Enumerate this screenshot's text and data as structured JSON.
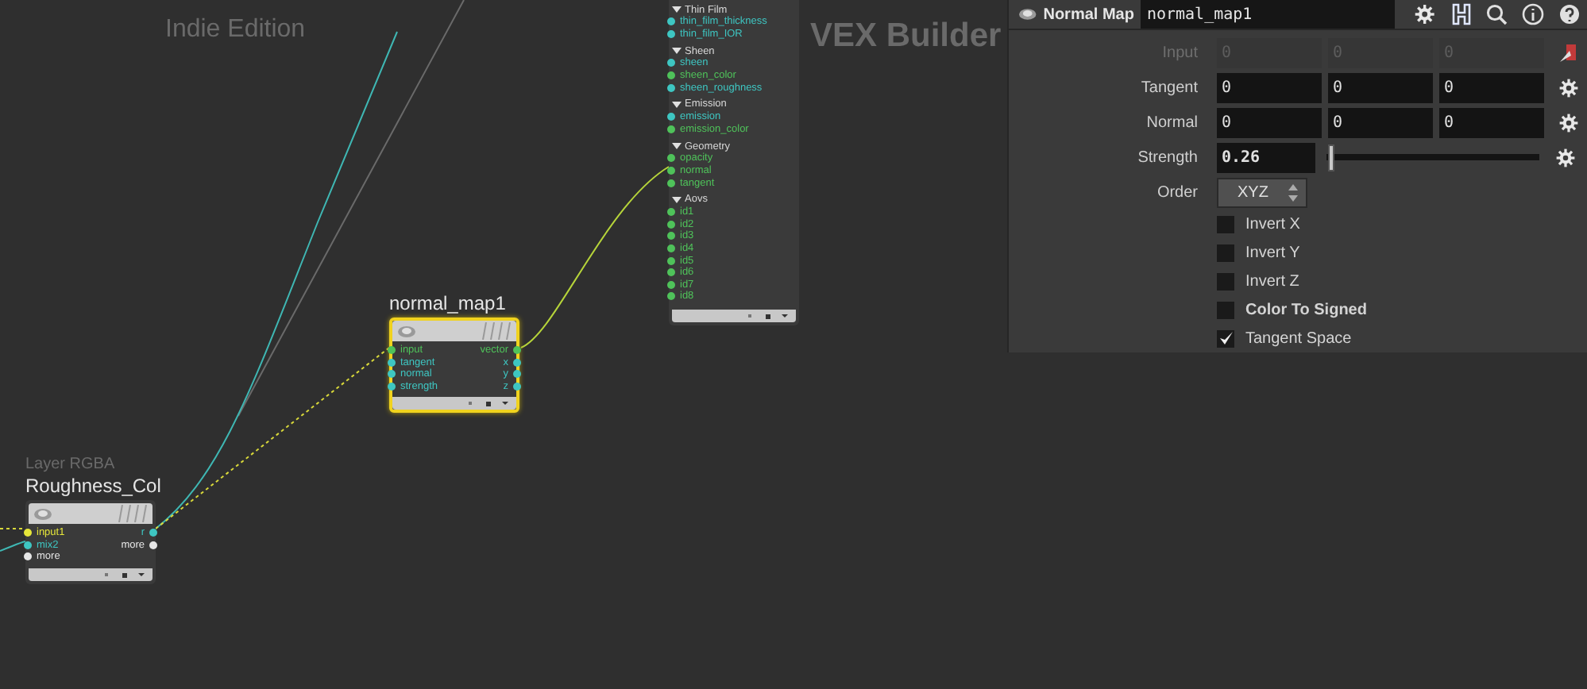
{
  "canvas": {
    "edition_label": "Indie Edition",
    "context_label": "VEX Builder"
  },
  "nodes": [
    {
      "kind": "sectioned",
      "sections": [
        {
          "title": "Thin Film",
          "ports": [
            {
              "name": "thin_film_thickness",
              "color": "#3ec6c2"
            },
            {
              "name": "thin_film_IOR",
              "color": "#3ec6c2"
            }
          ]
        },
        {
          "title": "Sheen",
          "ports": [
            {
              "name": "sheen",
              "color": "#3ec6c2"
            },
            {
              "name": "sheen_color",
              "color": "#4fc25a"
            },
            {
              "name": "sheen_roughness",
              "color": "#3ec6c2"
            }
          ]
        },
        {
          "title": "Emission",
          "ports": [
            {
              "name": "emission",
              "color": "#3ec6c2"
            },
            {
              "name": "emission_color",
              "color": "#4fc25a"
            }
          ]
        },
        {
          "title": "Geometry",
          "ports": [
            {
              "name": "opacity",
              "color": "#4fc25a"
            },
            {
              "name": "normal",
              "color": "#4fc25a"
            },
            {
              "name": "tangent",
              "color": "#4fc25a"
            }
          ]
        },
        {
          "title": "Aovs",
          "ports": [
            {
              "name": "id1",
              "color": "#4fc25a"
            },
            {
              "name": "id2",
              "color": "#4fc25a"
            },
            {
              "name": "id3",
              "color": "#4fc25a"
            },
            {
              "name": "id4",
              "color": "#4fc25a"
            },
            {
              "name": "id5",
              "color": "#4fc25a"
            },
            {
              "name": "id6",
              "color": "#4fc25a"
            },
            {
              "name": "id7",
              "color": "#4fc25a"
            },
            {
              "name": "id8",
              "color": "#4fc25a"
            }
          ]
        }
      ]
    },
    {
      "kind": "standard",
      "name": "normal_map1",
      "selected": true,
      "inputs": [
        {
          "name": "input",
          "color": "#4fc25a"
        },
        {
          "name": "tangent",
          "color": "#3ec6c2"
        },
        {
          "name": "normal",
          "color": "#3ec6c2"
        },
        {
          "name": "strength",
          "color": "#3ec6c2"
        }
      ],
      "outputs": [
        {
          "name": "vector",
          "color": "#4fc25a"
        },
        {
          "name": "x",
          "color": "#3ec6c2"
        },
        {
          "name": "y",
          "color": "#3ec6c2"
        },
        {
          "name": "z",
          "color": "#3ec6c2"
        }
      ]
    },
    {
      "kind": "standard",
      "type_label": "Layer RGBA",
      "name": "Roughness_Col",
      "selected": false,
      "inputs": [
        {
          "name": "input1",
          "color": "#e6e63a"
        },
        {
          "name": "mix2",
          "color": "#3ec6c2"
        },
        {
          "name": "more",
          "color": "#e6e6e6"
        }
      ],
      "outputs": [
        {
          "name": "r",
          "color": "#3ec6c2"
        },
        {
          "name": "more",
          "color": "#e6e6e6"
        }
      ]
    }
  ],
  "parameters": {
    "type_label": "Normal Map",
    "node_name": "normal_map1",
    "rows": [
      {
        "kind": "vector",
        "label": "Input",
        "disabled": true,
        "values": [
          "0",
          "0",
          "0"
        ]
      },
      {
        "kind": "vector",
        "label": "Tangent",
        "disabled": false,
        "values": [
          "0",
          "0",
          "0"
        ]
      },
      {
        "kind": "vector",
        "label": "Normal",
        "disabled": false,
        "values": [
          "0",
          "0",
          "0"
        ]
      },
      {
        "kind": "slider",
        "label": "Strength",
        "value": "0.26",
        "level": 0.02
      },
      {
        "kind": "menu",
        "label": "Order",
        "value": "XYZ"
      },
      {
        "kind": "checkbox",
        "label": "Invert X",
        "checked": false,
        "bold": false
      },
      {
        "kind": "checkbox",
        "label": "Invert Y",
        "checked": false,
        "bold": false
      },
      {
        "kind": "checkbox",
        "label": "Invert Z",
        "checked": false,
        "bold": false
      },
      {
        "kind": "checkbox",
        "label": "Color To Signed",
        "checked": false,
        "bold": true
      },
      {
        "kind": "checkbox",
        "label": "Tangent Space",
        "checked": true,
        "bold": false
      }
    ]
  }
}
